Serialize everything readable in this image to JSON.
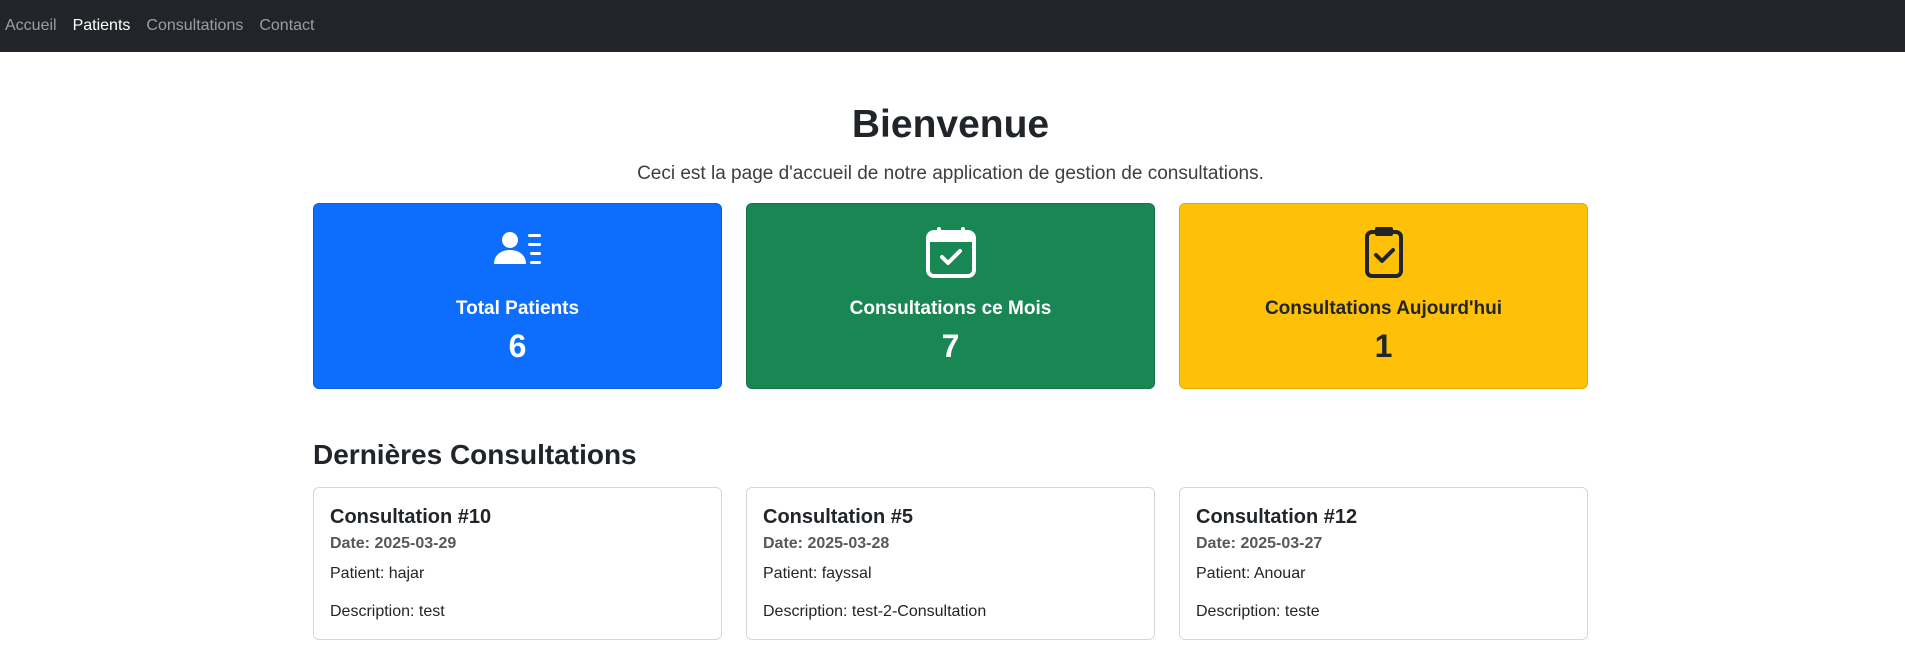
{
  "nav": {
    "items": [
      {
        "label": "Accueil",
        "active": false
      },
      {
        "label": "Patients",
        "active": true
      },
      {
        "label": "Consultations",
        "active": false
      },
      {
        "label": "Contact",
        "active": false
      }
    ]
  },
  "hero": {
    "title": "Bienvenue",
    "subtitle": "Ceci est la page d'accueil de notre application de gestion de consultations."
  },
  "stats": [
    {
      "icon": "person-lines-icon",
      "label": "Total Patients",
      "value": "6",
      "color": "#0d6efd"
    },
    {
      "icon": "calendar-check-icon",
      "label": "Consultations ce Mois",
      "value": "7",
      "color": "#198754"
    },
    {
      "icon": "clipboard-check-icon",
      "label": "Consultations Aujourd'hui",
      "value": "1",
      "color": "#ffc107"
    }
  ],
  "recent": {
    "title": "Dernières Consultations",
    "items": [
      {
        "title": "Consultation #10",
        "date": "Date: 2025-03-29",
        "patient": "Patient: hajar",
        "description": "Description: test"
      },
      {
        "title": "Consultation #5",
        "date": "Date: 2025-03-28",
        "patient": "Patient: fayssal",
        "description": "Description: test-2-Consultation"
      },
      {
        "title": "Consultation #12",
        "date": "Date: 2025-03-27",
        "patient": "Patient: Anouar",
        "description": "Description: teste"
      }
    ]
  }
}
